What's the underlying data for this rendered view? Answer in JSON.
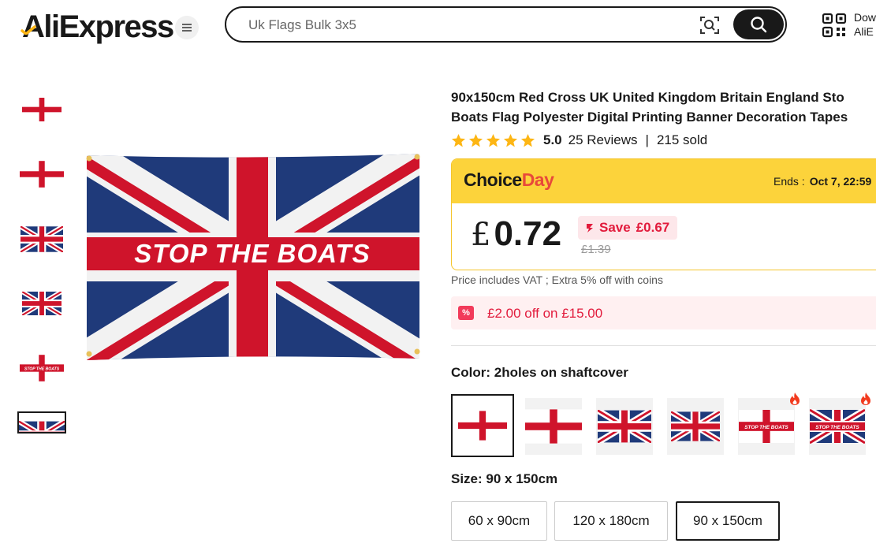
{
  "header": {
    "logo_text": "AliExpress",
    "search_placeholder": "Uk Flags Bulk 3x5",
    "download_line1": "Dow",
    "download_line2": "AliE"
  },
  "gallery": {
    "thumbnails": [
      "england-flag",
      "england-flag",
      "union-jack",
      "union-jack",
      "stop-the-boats-england",
      "stop-the-boats-union-jack"
    ],
    "main_banner_text": "STOP THE BOATS"
  },
  "product": {
    "title_line1": "90x150cm Red Cross UK United Kingdom Britain England Sto",
    "title_line2": "Boats Flag Polyester Digital Printing Banner Decoration Tapes",
    "rating": "5.0",
    "reviews": "25 Reviews",
    "separator": "|",
    "sold": "215 sold"
  },
  "choice_day": {
    "logo_choice": "Choice",
    "logo_day": "Day",
    "ends_label": "Ends :",
    "ends_value": "Oct 7, 22:59",
    "currency": "£",
    "price": "0.72",
    "save_label": "Save",
    "save_amount": "£0.67",
    "original_price": "£1.39"
  },
  "vat_note": "Price includes VAT ; Extra 5% off with coins",
  "coupon": {
    "icon_text": "%",
    "text": "£2.00 off on £15.00"
  },
  "color": {
    "label": "Color: 2holes on shaftcover",
    "options": [
      "england-flag",
      "england-flag",
      "union-jack",
      "union-jack",
      "stop-the-boats-england",
      "stop-the-boats-union-jack"
    ],
    "selected_index": 0,
    "hot_indices": [
      4,
      5
    ]
  },
  "size": {
    "label": "Size: 90 x 150cm",
    "options": [
      "60 x 90cm",
      "120 x 180cm",
      "90 x 150cm"
    ],
    "selected": "90 x 150cm"
  },
  "colors": {
    "flag_red": "#cf142b",
    "flag_blue": "#1f3a7a",
    "choice_yellow": "#fcd33b",
    "accent_red": "#e21b3c"
  }
}
